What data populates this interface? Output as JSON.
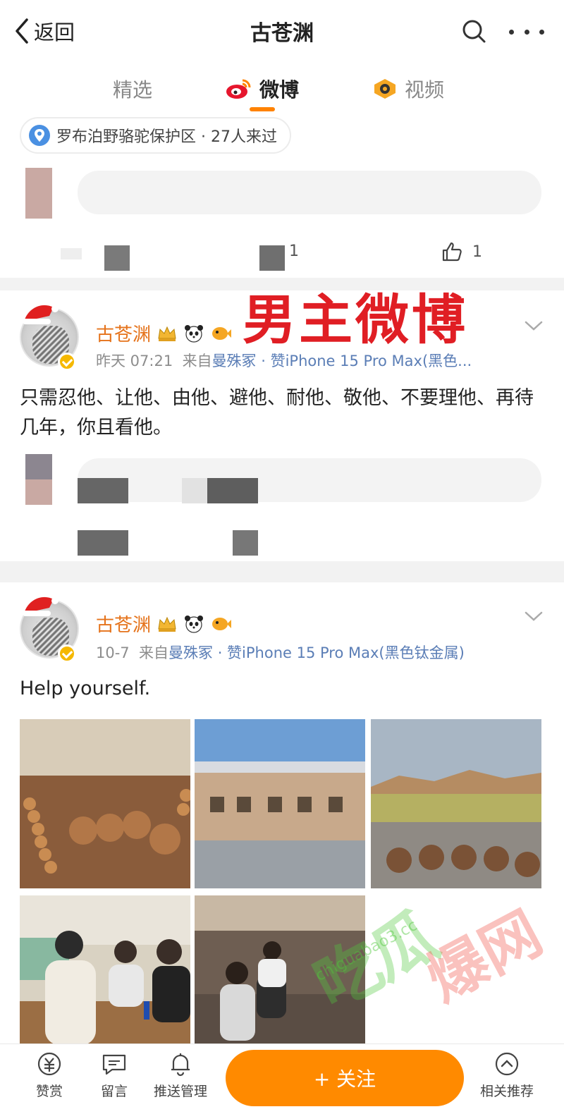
{
  "header": {
    "back_label": "返回",
    "title": "古苍渊"
  },
  "tabs": [
    {
      "label": "精选"
    },
    {
      "label": "微博"
    },
    {
      "label": "视频"
    }
  ],
  "location": {
    "text": "罗布泊野骆驼保护区 · 27人来过"
  },
  "card1": {
    "comment_count": "1",
    "like_count": "1"
  },
  "overlay_text": "男主微博",
  "posts": [
    {
      "username": "古苍渊",
      "time": "昨天 07:21",
      "source_prefix": "来自",
      "source": "曼殊冢 · 赞iPhone 15 Pro Max(黑色...",
      "text": "只需忍他、让他、由他、避他、耐他、敬他、不要理他、再待几年，你且看他。"
    },
    {
      "username": "古苍渊",
      "time": "10-7",
      "source_prefix": "来自",
      "source": "曼殊冢 · 赞iPhone 15 Pro Max(黑色钛金属)",
      "text": "Help yourself."
    }
  ],
  "bottom_bar": {
    "reward": "赞赏",
    "message": "留言",
    "push": "推送管理",
    "follow": "+ 关注",
    "related": "相关推荐"
  },
  "watermark": {
    "url": "chiguabao3.cc",
    "text_left": "吃瓜",
    "text_right": "爆网"
  },
  "colors": {
    "accent": "#ff8200",
    "username": "#e5731b",
    "overlay": "#e01e24"
  }
}
